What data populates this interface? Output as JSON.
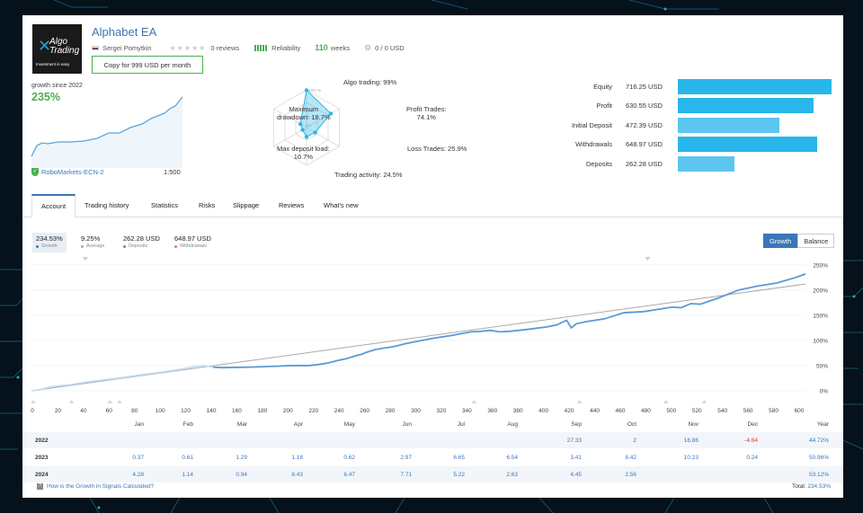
{
  "ea": {
    "title": "Alphabet EA",
    "author": "Sergei Pomytkin",
    "reviews": "0 reviews",
    "reliability": "Reliability",
    "weeks_value": "110",
    "weeks_label": "weeks",
    "subscribers": "0 / 0 USD",
    "copy_button": "Copy for 999 USD per month",
    "logo": {
      "line1": "Algo",
      "line2": "Trading",
      "tagline": "Investment is easy"
    }
  },
  "growth": {
    "since": "growth since 2022",
    "percent": "235%",
    "broker": "RoboMarkets-ECN-2",
    "leverage": "1:500"
  },
  "radar": {
    "algo": "Algo trading: 99%",
    "profit_trades": "Profit Trades:",
    "profit_trades_v": "74.1%",
    "loss_trades": "Loss Trades: 25.9%",
    "activity": "Trading activity: 24.5%",
    "max_dd": "Maximum",
    "max_dd2": "drawdown: 18.7%",
    "max_load": "Max deposit load:",
    "max_load_v": "10.7%",
    "ring_100": "100+%",
    "ring_50": "50%",
    "ring_0": "0%",
    "values": {
      "algo": 0.99,
      "profit_trades": 0.741,
      "loss_trades": 0.259,
      "activity": 0.245,
      "max_load": 0.107,
      "max_dd": 0.187
    }
  },
  "stats": [
    {
      "label": "Equity",
      "value": "716.25 USD",
      "amount": 716.25,
      "color": "#29b6ea"
    },
    {
      "label": "Profit",
      "value": "630.55 USD",
      "amount": 630.55,
      "color": "#29b6ea"
    },
    {
      "label": "Initial Deposit",
      "value": "472.39 USD",
      "amount": 472.39,
      "color": "#5cc6f0"
    },
    {
      "label": "Withdrawals",
      "value": "648.97 USD",
      "amount": 648.97,
      "color": "#29b6ea"
    },
    {
      "label": "Deposits",
      "value": "262.28 USD",
      "amount": 262.28,
      "color": "#5cc6f0"
    }
  ],
  "tabs": [
    "Account",
    "Trading history",
    "Statistics",
    "Risks",
    "Slippage",
    "Reviews",
    "What's new"
  ],
  "graph_tabs": [
    {
      "value": "234.53%",
      "label": "Growth",
      "color": "#3b76b8"
    },
    {
      "value": "9.25%",
      "label": "Average",
      "color": "#aaa"
    },
    {
      "value": "262.28 USD",
      "label": "Deposits",
      "color": "#4caf50"
    },
    {
      "value": "648.97 USD",
      "label": "Withdrawals",
      "color": "#e57373"
    }
  ],
  "toggle": {
    "growth": "Growth",
    "balance": "Balance"
  },
  "chart_data": {
    "type": "line",
    "xlim": [
      0,
      810
    ],
    "ylim": [
      -25,
      255
    ],
    "x_ticks": [
      "0",
      "20",
      "40",
      "60",
      "80",
      "100",
      "120",
      "140",
      "160",
      "180",
      "200",
      "220",
      "240",
      "260",
      "280",
      "300",
      "320",
      "340",
      "360",
      "380",
      "400",
      "420",
      "440",
      "460",
      "480",
      "500",
      "520",
      "540",
      "560",
      "580",
      "600"
    ],
    "y_ticks": [
      "250%",
      "200%",
      "150%",
      "100%",
      "50%",
      "0%"
    ],
    "y_tick_values": [
      250,
      200,
      150,
      100,
      50,
      0
    ],
    "series": [
      {
        "x": [
          0,
          10,
          20,
          40,
          60,
          90,
          120,
          140,
          160,
          170,
          180,
          190,
          200,
          230,
          260,
          270,
          290,
          300,
          310,
          320,
          330,
          340,
          345,
          350,
          360,
          380,
          390,
          400,
          420,
          440,
          460,
          470,
          480,
          490,
          500,
          520,
          540,
          550,
          560,
          565,
          570,
          580,
          600,
          620,
          640,
          660,
          670,
          680,
          690,
          700,
          720,
          740,
          760,
          780,
          800,
          810
        ],
        "y": [
          0,
          3,
          8,
          12,
          18,
          25,
          33,
          38,
          44,
          48,
          50,
          47,
          46,
          47,
          49,
          50,
          50,
          52,
          55,
          60,
          64,
          70,
          72,
          76,
          82,
          88,
          93,
          97,
          104,
          110,
          117,
          118,
          120,
          117,
          118,
          122,
          127,
          131,
          140,
          125,
          133,
          137,
          143,
          155,
          157,
          163,
          166,
          165,
          173,
          172,
          185,
          200,
          208,
          214,
          225,
          232
        ]
      },
      {
        "x": [
          0,
          810
        ],
        "y": [
          0,
          212
        ]
      }
    ],
    "x_markers_top": [
      0,
      22,
      31
    ],
    "x_markers_bottom": [
      0,
      4,
      8,
      9,
      46,
      57,
      66,
      70
    ]
  },
  "table": {
    "months": [
      "Jan",
      "Feb",
      "Mar",
      "Apr",
      "May",
      "Jun",
      "Jul",
      "Aug",
      "Sep",
      "Oct",
      "Nov",
      "Dec",
      "Year"
    ],
    "rows": [
      {
        "year": "2022",
        "cells": [
          "",
          "",
          "",
          "",
          "",
          "",
          "",
          "",
          "27.33",
          "2",
          "16.86",
          "-4.64",
          "44.72%"
        ]
      },
      {
        "year": "2023",
        "cells": [
          "0.37",
          "0.61",
          "1.29",
          "1.18",
          "0.62",
          "2.97",
          "6.65",
          "6.54",
          "3.41",
          "8.42",
          "10.23",
          "0.24",
          "50.96%"
        ]
      },
      {
        "year": "2024",
        "cells": [
          "4.28",
          "1.14",
          "0.94",
          "8.43",
          "6.47",
          "7.71",
          "5.22",
          "2.63",
          "4.45",
          "2.56",
          "",
          "",
          "53.12%"
        ]
      }
    ]
  },
  "footer": {
    "how": "How is the Growth in Signals Calculated?",
    "total_label": "Total:",
    "total_value": "234.53%"
  }
}
